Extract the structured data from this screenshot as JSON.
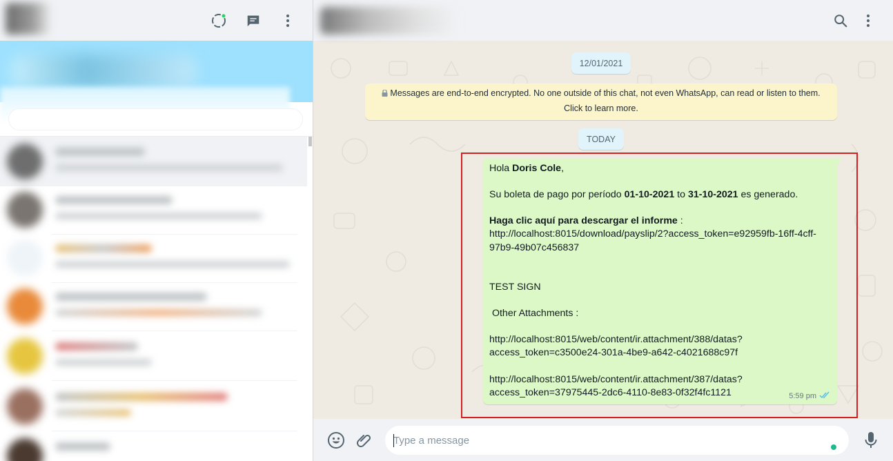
{
  "left_panel": {
    "header": {
      "status_icon": "status-icon",
      "new_chat_icon": "new-chat-icon",
      "menu_icon": "menu-icon",
      "status_dot_color": "#25d366"
    }
  },
  "chat": {
    "header": {
      "search_icon": "search-icon",
      "menu_icon": "menu-icon"
    },
    "date_chips": [
      "12/01/2021",
      "TODAY"
    ],
    "encryption_notice": {
      "line1": "Messages are end-to-end encrypted. No one outside of this chat, not even WhatsApp, can read or listen to them.",
      "line2": "Click to learn more."
    },
    "message": {
      "greeting": "Hola ",
      "name": "Doris Cole",
      "greeting_end": ",",
      "period_prefix": "Su boleta de pago por período ",
      "period_start": "01-10-2021",
      "period_to": " to ",
      "period_end": "31-10-2021",
      "period_suffix": " es generado.",
      "download_label": "Haga clic aquí para descargar el informe",
      "download_colon": " :",
      "download_url_1": "http://localhost:8015/download/payslip/2?access_token=e92959fb-16ff-4cff-",
      "download_url_2": "97b9-49b07c456837",
      "sign": "TEST SIGN",
      "attachments_label": " Other Attachments :",
      "attachment1_line1": "http://localhost:8015/web/content/ir.attachment/388/datas?",
      "attachment1_line2": "access_token=c3500e24-301a-4be9-a642-c4021688c97f",
      "attachment2_line1": "http://localhost:8015/web/content/ir.attachment/387/datas?",
      "attachment2_line2": "access_token=37975445-2dc6-4110-8e83-0f32f4fc1121",
      "time": "5:59 pm",
      "status_icon": "double-check-icon"
    },
    "composer": {
      "placeholder": "Type a message",
      "emoji_icon": "emoji-icon",
      "attach_icon": "paperclip-icon",
      "mic_icon": "microphone-icon"
    }
  },
  "colors": {
    "bubble_outgoing": "#dcf8c6",
    "highlight_border": "#d51f22",
    "read_tick": "#53bdeb",
    "chat_background": "#efeae2"
  }
}
